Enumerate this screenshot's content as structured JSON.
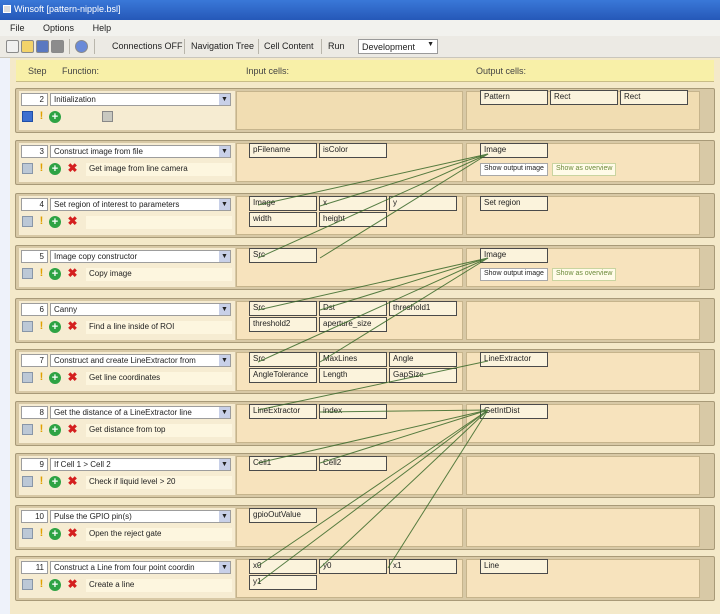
{
  "window": {
    "title": "Winsoft [pattern-nipple.bsl]"
  },
  "menu": [
    "File",
    "Options",
    "Help"
  ],
  "toolbar": {
    "connections": "Connections OFF",
    "nav_tree": "Navigation Tree",
    "cell_content": "Cell Content",
    "run": "Run",
    "mode": "Development"
  },
  "header": {
    "step": "Step",
    "function": "Function:",
    "input": "Input cells:",
    "output": "Output cells:"
  },
  "steps": [
    {
      "num": "2",
      "func": "Initialization",
      "comment": "",
      "inputs": [],
      "outputs": [
        "Pattern",
        "Rect",
        "Rect"
      ]
    },
    {
      "num": "3",
      "func": "Construct image from file",
      "comment": "Get image from line camera",
      "inputs": [
        "pFilename",
        "isColor"
      ],
      "outputs": [
        "Image"
      ],
      "buttons": [
        "Show output image",
        "Show as overview"
      ]
    },
    {
      "num": "4",
      "func": "Set region of interest to parameters",
      "comment": "",
      "inputs": [
        "Image",
        "x",
        "y",
        "width",
        "height"
      ],
      "outputs": [
        "Set region"
      ]
    },
    {
      "num": "5",
      "func": "Image copy constructor",
      "comment": "Copy image",
      "inputs": [
        "Src"
      ],
      "outputs": [
        "Image"
      ],
      "buttons": [
        "Show output image",
        "Show as overview"
      ]
    },
    {
      "num": "6",
      "func": "Canny",
      "comment": "Find a line inside of ROI",
      "inputs": [
        "Src",
        "Dst",
        "threshold1",
        "threshold2",
        "aperture_size"
      ],
      "outputs": []
    },
    {
      "num": "7",
      "func": "Construct and create LineExtractor from",
      "comment": "Get line coordinates",
      "inputs": [
        "Src",
        "MaxLines",
        "Angle",
        "AngleTolerance",
        "Length",
        "GapSize"
      ],
      "outputs": [
        "LineExtractor"
      ]
    },
    {
      "num": "8",
      "func": "Get the distance of a LineExtractor line",
      "comment": "Get distance from top",
      "inputs": [
        "LineExtractor",
        "index"
      ],
      "outputs": [
        "GetIntDist"
      ]
    },
    {
      "num": "9",
      "func": "If Cell 1 > Cell 2",
      "comment": "Check if liquid level > 20",
      "inputs": [
        "Cell1",
        "Cell2"
      ],
      "outputs": []
    },
    {
      "num": "10",
      "func": "Pulse the GPIO pin(s)",
      "comment": "Open the reject gate",
      "inputs": [
        "gpioOutValue"
      ],
      "outputs": []
    },
    {
      "num": "11",
      "func": "Construct a Line from four point coordin",
      "comment": "Create a line",
      "inputs": [
        "x0",
        "y0",
        "x1",
        "y1"
      ],
      "outputs": [
        "Line"
      ]
    }
  ],
  "colors": {
    "titlebar": "#2a60c4",
    "header": "#f8f0a8",
    "panel": "#f7e3bd",
    "link": "#3a6a2a"
  }
}
